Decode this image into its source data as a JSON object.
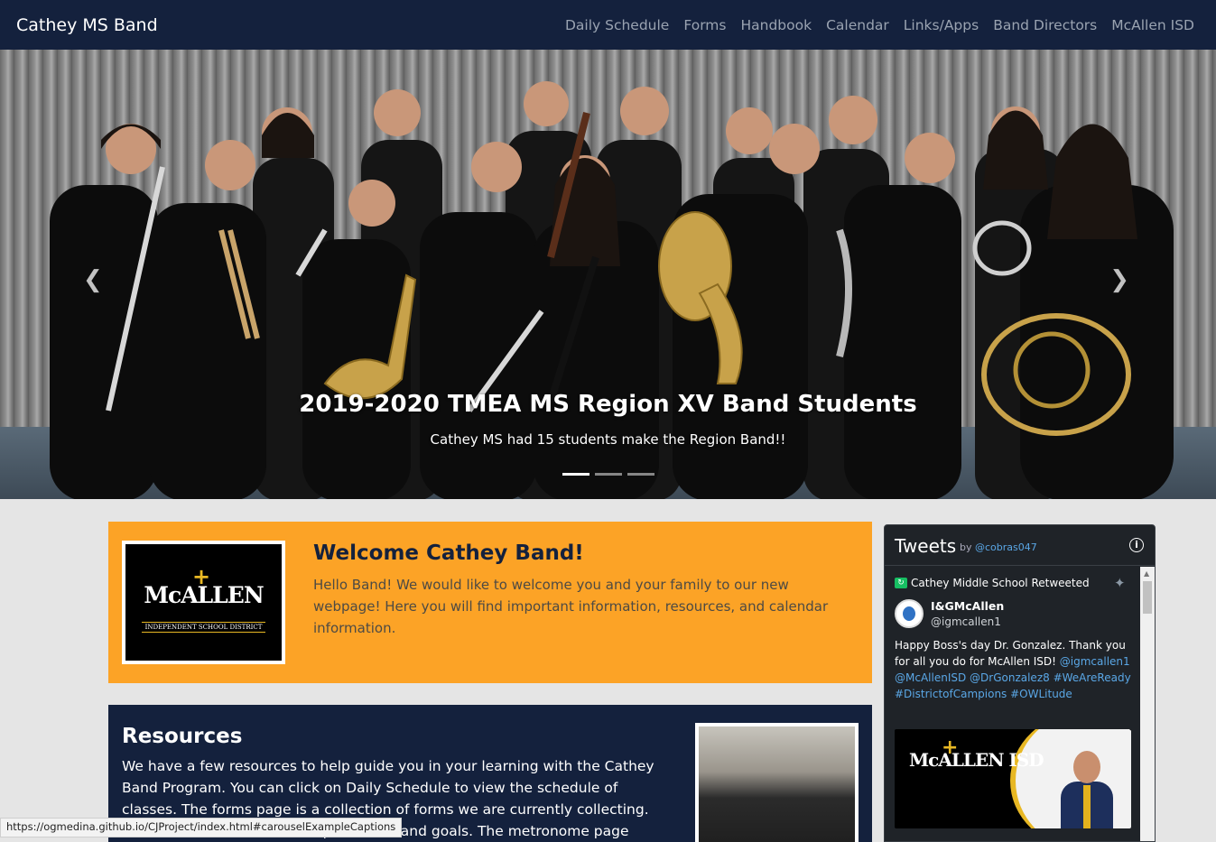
{
  "navbar": {
    "brand": "Cathey MS Band",
    "links": [
      "Daily Schedule",
      "Forms",
      "Handbook",
      "Calendar",
      "Links/Apps",
      "Band Directors",
      "McAllen ISD"
    ]
  },
  "carousel": {
    "caption_title": "2019-2020 TMEA MS Region XV Band Students",
    "caption_text": "Cathey MS had 15 students make the Region Band!!",
    "active_slide": 1,
    "slide_count": 3
  },
  "welcome": {
    "logo_text": "McALLEN",
    "logo_subtext": "INDEPENDENT SCHOOL DISTRICT",
    "title": "Welcome Cathey Band!",
    "text": "Hello Band! We would like to welcome you and your family to our new webpage! Here you will find important information, resources, and calendar information."
  },
  "resources": {
    "title": "Resources",
    "text": "We have a few resources to help guide you in your learning with the Cathey Band Program. You can click on Daily Schedule to view the schedule of classes. The forms page is a collection of forms we are currently collecting. The Handbook details the expectations and goals. The metronome page"
  },
  "tweets": {
    "title": "Tweets",
    "by": "by",
    "handle": "@cobras047",
    "retweet_label": "Cathey Middle School Retweeted",
    "author_name": "I&GMcAllen",
    "author_handle": "@igmcallen1",
    "text_plain": "Happy Boss's day Dr. Gonzalez.  Thank you for all you do for McAllen ISD!",
    "text_links": "@igmcallen1 @McAllenISD @DrGonzalez8 #WeAreReady #DistrictofCampions #OWLitude",
    "media_logo": "McALLEN ISD"
  },
  "statusbar": {
    "url": "https://ogmedina.github.io/CJProject/index.html#carouselExampleCaptions"
  },
  "colors": {
    "navy": "#14213d",
    "orange": "#fca326",
    "gold": "#e8b824"
  }
}
